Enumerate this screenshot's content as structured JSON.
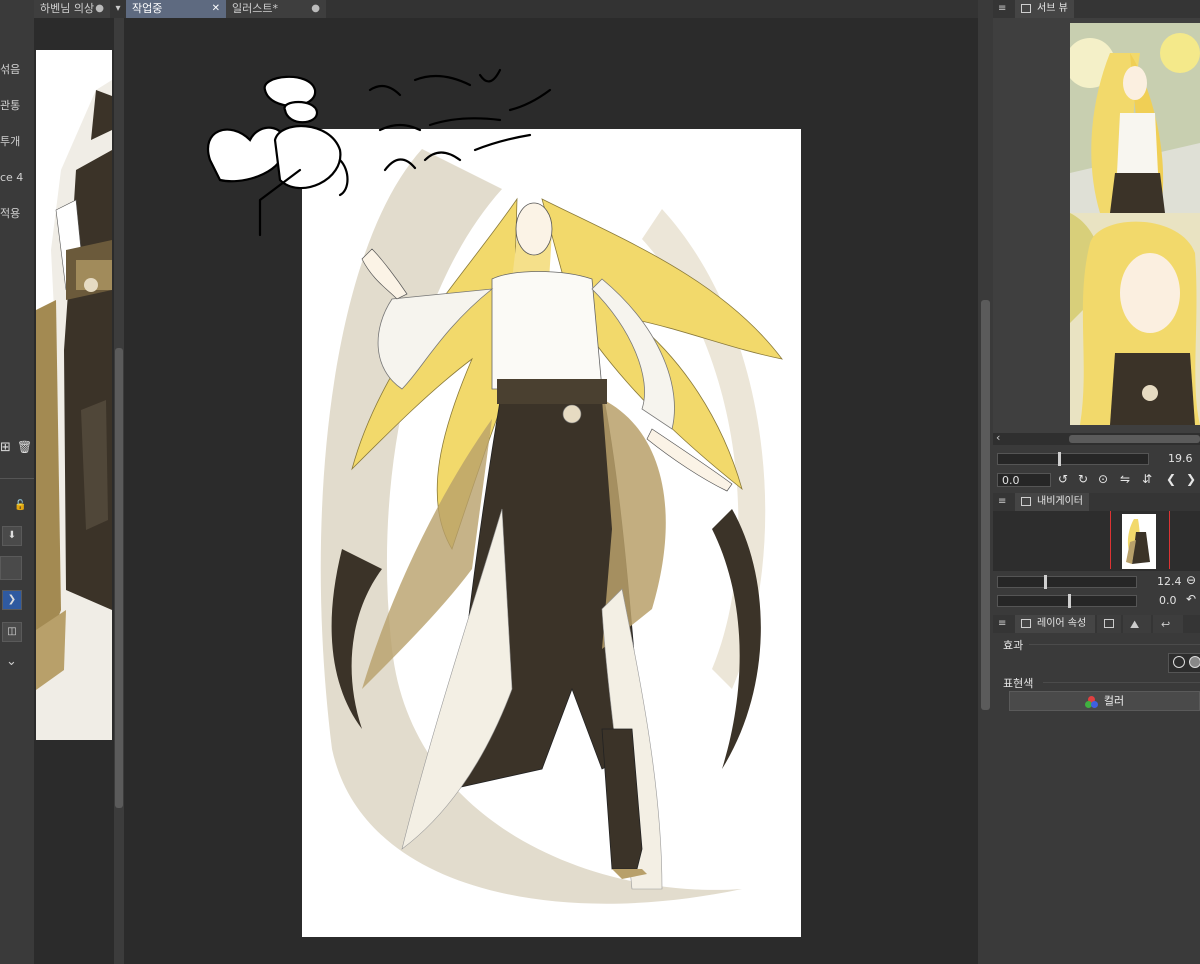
{
  "left_panel": {
    "tool_labels": [
      "섞음",
      "관통",
      "투개",
      "ce 4",
      "적용"
    ]
  },
  "tabs": {
    "left_tab": {
      "label": "하벤님 의상",
      "close": "●"
    },
    "active_tab": {
      "label": "작업중",
      "close": "✕"
    },
    "second_tab": {
      "label": "일러스트*",
      "close": "●"
    }
  },
  "right_panel": {
    "sub_view": {
      "title": "서브 뷰",
      "zoom": "19.6"
    },
    "navigator": {
      "title": "내비게이터",
      "zoom": "12.4",
      "rotation": "0.0"
    },
    "slider_left_value": "0.0",
    "layer_props": {
      "title": "레이어 속성",
      "effect_label": "효과",
      "expression_label": "표현색",
      "color_button": "컬러"
    }
  },
  "icons": {
    "rotate_left": "↺",
    "rotate_right": "↻",
    "reset": "⊙",
    "flip_h": "⇋",
    "flip_v": "⇵",
    "prev": "❮",
    "next": "❯",
    "add_layer": "⊞",
    "delete": "🗑",
    "lock": "🔓",
    "download": "⬇",
    "chevron": "⌄",
    "minus": "⊖",
    "undo": "↶",
    "hamburger": "≡",
    "scroll_left": "‹"
  },
  "colors": {
    "paper": "#ffffff",
    "hair": "#f2d96b",
    "robe_dark": "#3b3328",
    "robe_tan": "#b8a06a",
    "bg_shape": "#d9d0bf"
  }
}
